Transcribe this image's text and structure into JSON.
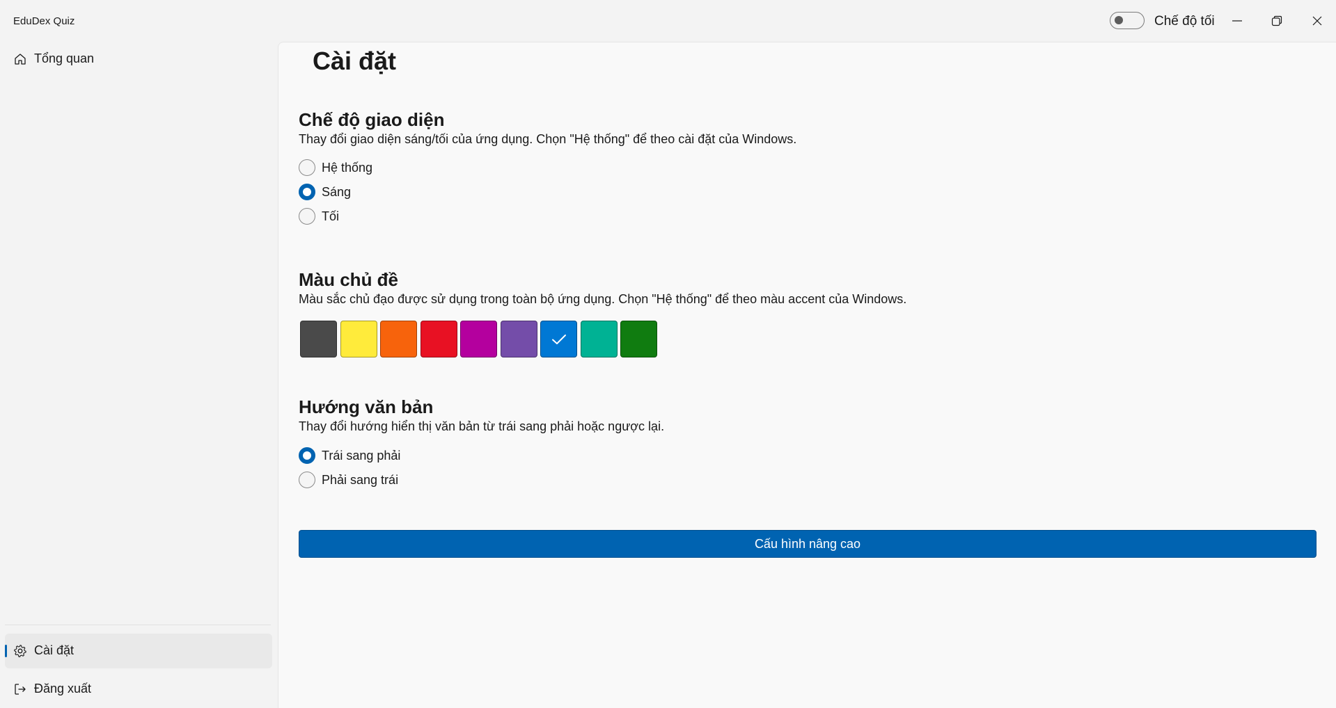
{
  "window": {
    "app_title": "EduDex Quiz",
    "dark_mode_toggle": {
      "label": "Chế độ tối",
      "on": false
    },
    "controls": [
      "minimize-icon",
      "restore-icon",
      "close-icon"
    ]
  },
  "sidebar": {
    "items": [
      {
        "label": "Tổng quan",
        "icon": "home-icon",
        "selected": false
      },
      {
        "label": "Cài đặt",
        "icon": "gear-icon",
        "selected": true
      },
      {
        "label": "Đăng xuất",
        "icon": "sign-out-icon",
        "selected": false
      }
    ]
  },
  "page": {
    "title": "Cài đặt",
    "theme_mode": {
      "title": "Chế độ giao diện",
      "description": "Thay đổi giao diện sáng/tối của ứng dụng. Chọn \"Hệ thống\" để theo cài đặt của Windows.",
      "options": [
        {
          "label": "Hệ thống",
          "checked": false
        },
        {
          "label": "Sáng",
          "checked": true
        },
        {
          "label": "Tối",
          "checked": false
        }
      ]
    },
    "accent_color": {
      "title": "Màu chủ đề",
      "description": "Màu sắc chủ đạo được sử dụng trong toàn bộ ứng dụng. Chọn \"Hệ thống\" để theo màu accent của Windows.",
      "swatches": [
        {
          "color": "#4a4a4a",
          "selected": false
        },
        {
          "color": "#ffeb3b",
          "selected": false
        },
        {
          "color": "#f7630c",
          "selected": false
        },
        {
          "color": "#e81123",
          "selected": false
        },
        {
          "color": "#b4009e",
          "selected": false
        },
        {
          "color": "#744da9",
          "selected": false
        },
        {
          "color": "#0078d4",
          "selected": true
        },
        {
          "color": "#00b294",
          "selected": false
        },
        {
          "color": "#107c10",
          "selected": false
        }
      ]
    },
    "text_direction": {
      "title": "Hướng văn bản",
      "description": "Thay đổi hướng hiển thị văn bản từ trái sang phải hoặc ngược lại.",
      "options": [
        {
          "label": "Trái sang phải",
          "checked": true
        },
        {
          "label": "Phải sang trái",
          "checked": false
        }
      ]
    },
    "advanced_button": {
      "label": "Cấu hình nâng cao"
    }
  },
  "colors": {
    "accent": "#0063b1",
    "background": "#f3f3f3",
    "content_background": "#f9f9f9"
  }
}
